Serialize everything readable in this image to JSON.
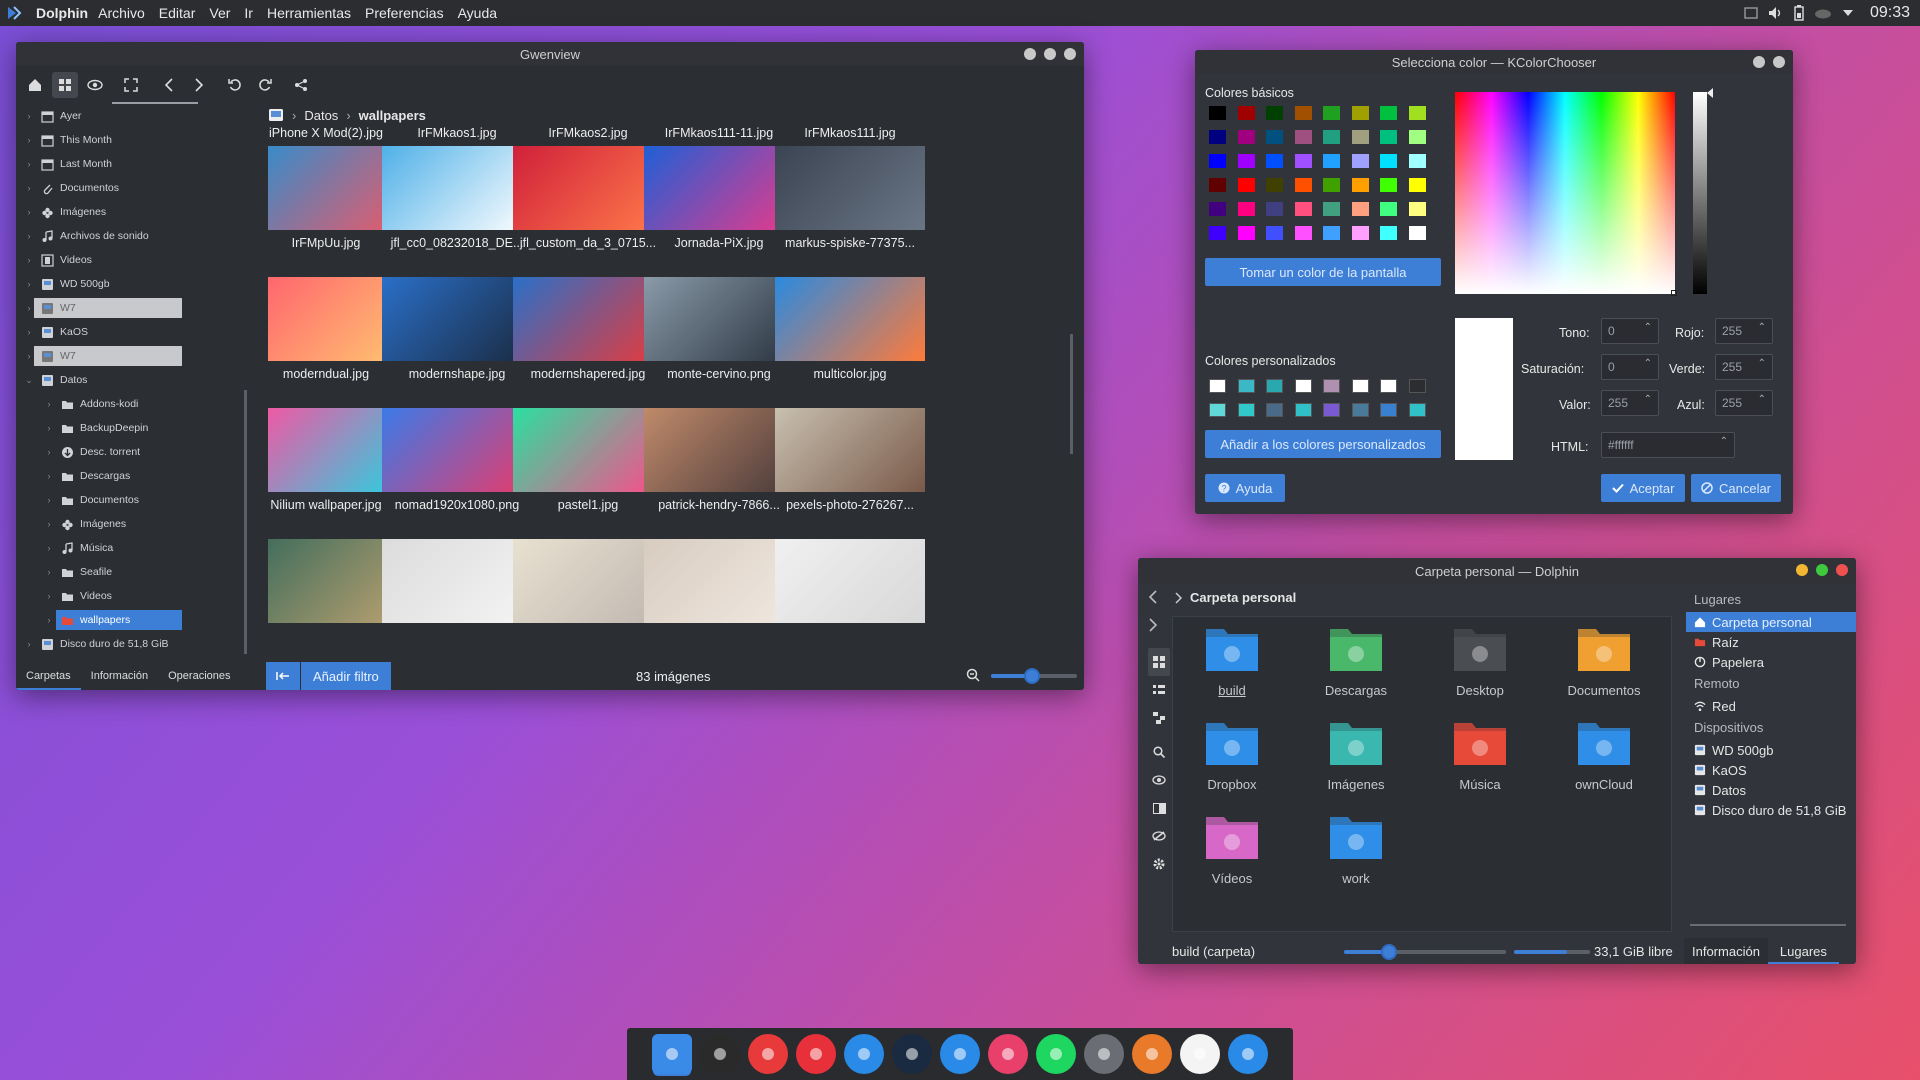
{
  "topbar": {
    "app": "Dolphin",
    "menu": [
      "Archivo",
      "Editar",
      "Ver",
      "Ir",
      "Herramientas",
      "Preferencias",
      "Ayuda"
    ],
    "clock": "09:33"
  },
  "gwenview": {
    "title": "Gwenview",
    "tree": [
      {
        "label": "Ayer",
        "icon": "calendar-icon",
        "level": 0
      },
      {
        "label": "This Month",
        "icon": "calendar-icon",
        "level": 0
      },
      {
        "label": "Last Month",
        "icon": "calendar-icon",
        "level": 0
      },
      {
        "label": "Documentos",
        "icon": "paperclip-icon",
        "level": 0
      },
      {
        "label": "Imágenes",
        "icon": "flower-icon",
        "level": 0
      },
      {
        "label": "Archivos de sonido",
        "icon": "music-icon",
        "level": 0
      },
      {
        "label": "Videos",
        "icon": "film-icon",
        "level": 0
      },
      {
        "label": "WD 500gb",
        "icon": "drive-icon",
        "level": 0
      },
      {
        "label": "W7",
        "icon": "drive-icon",
        "level": 0,
        "state": "grey"
      },
      {
        "label": "KaOS",
        "icon": "drive-icon",
        "level": 0
      },
      {
        "label": "W7",
        "icon": "drive-icon",
        "level": 0,
        "state": "grey"
      },
      {
        "label": "Datos",
        "icon": "drive-icon",
        "level": 0,
        "expanded": true
      },
      {
        "label": "Addons-kodi",
        "icon": "folder-icon",
        "level": 1
      },
      {
        "label": "BackupDeepin",
        "icon": "folder-icon",
        "level": 1
      },
      {
        "label": "Desc. torrent",
        "icon": "download-icon",
        "level": 1
      },
      {
        "label": "Descargas",
        "icon": "folder-icon",
        "level": 1
      },
      {
        "label": "Documentos",
        "icon": "folder-icon",
        "level": 1
      },
      {
        "label": "Imágenes",
        "icon": "flower-icon",
        "level": 1
      },
      {
        "label": "Música",
        "icon": "music-icon",
        "level": 1
      },
      {
        "label": "Seafile",
        "icon": "folder-icon",
        "level": 1
      },
      {
        "label": "Videos",
        "icon": "folder-icon",
        "level": 1
      },
      {
        "label": "wallpapers",
        "icon": "folder-red-icon",
        "level": 1,
        "state": "selected"
      },
      {
        "label": "Disco duro de 51,8 GiB",
        "icon": "drive-icon",
        "level": 0
      }
    ],
    "tabs": [
      "Carpetas",
      "Información",
      "Operaciones"
    ],
    "breadcrumb": [
      "Datos",
      "wallpapers"
    ],
    "top_captions": [
      "iPhone X Mod(2).jpg",
      "IrFMkaos1.jpg",
      "IrFMkaos2.jpg",
      "IrFMkaos111-11.jpg",
      "IrFMkaos111.jpg"
    ],
    "thumbs": [
      {
        "name": "IrFMpUu.jpg",
        "c1": "#2a8fd0",
        "c2": "#e85a6a"
      },
      {
        "name": "jfl_cc0_08232018_DE...",
        "c1": "#4fb0e8",
        "c2": "#ffffff"
      },
      {
        "name": "jfl_custom_da_3_0715...",
        "c1": "#d0203a",
        "c2": "#ff7a4a"
      },
      {
        "name": "Jornada-PiX.jpg",
        "c1": "#1f5fd6",
        "c2": "#e83a8a"
      },
      {
        "name": "markus-spiske-77375...",
        "c1": "#3a4452",
        "c2": "#6a7585"
      },
      {
        "name": "moderndual.jpg",
        "c1": "#ff5f6d",
        "c2": "#ffc371"
      },
      {
        "name": "modernshape.jpg",
        "c1": "#2a6fc8",
        "c2": "#1a2a40"
      },
      {
        "name": "modernshapered.jpg",
        "c1": "#2a6fc8",
        "c2": "#e83a3a"
      },
      {
        "name": "monte-cervino.png",
        "c1": "#8a9aa8",
        "c2": "#2a3440"
      },
      {
        "name": "multicolor.jpg",
        "c1": "#2a8ae0",
        "c2": "#ff7a3a"
      },
      {
        "name": "Nilium wallpaper.jpg",
        "c1": "#ff4fa0",
        "c2": "#2ad0e0"
      },
      {
        "name": "nomad1920x1080.png",
        "c1": "#3a7ae8",
        "c2": "#e83a6a"
      },
      {
        "name": "pastel1.jpg",
        "c1": "#2ae0a0",
        "c2": "#ff4a8a"
      },
      {
        "name": "patrick-hendry-7866...",
        "c1": "#c08a6a",
        "c2": "#4a3a3a"
      },
      {
        "name": "pexels-photo-276267...",
        "c1": "#c8c0b0",
        "c2": "#7a5a4a"
      },
      {
        "name": "",
        "c1": "#3a6a5a",
        "c2": "#b8a070"
      },
      {
        "name": "",
        "c1": "#dcdcdc",
        "c2": "#f4f4f4"
      },
      {
        "name": "",
        "c1": "#e8e0d0",
        "c2": "#c0b8b0"
      },
      {
        "name": "",
        "c1": "#d8ccc0",
        "c2": "#f0e8e0"
      },
      {
        "name": "",
        "c1": "#f0f0f0",
        "c2": "#d8d8d8"
      }
    ],
    "filter_label": "Añadir filtro",
    "count": "83 imágenes",
    "zoom_fraction": 0.48
  },
  "colorchooser": {
    "title": "Selecciona color — KColorChooser",
    "basic_label": "Colores básicos",
    "basic_colors": [
      "#000000",
      "#a00000",
      "#004000",
      "#a05000",
      "#20a020",
      "#a0a000",
      "#00c040",
      "#a0e020",
      "#000080",
      "#a00080",
      "#005080",
      "#a05080",
      "#20a080",
      "#a0a080",
      "#00c080",
      "#a0ff80",
      "#0000ff",
      "#a000ff",
      "#0050ff",
      "#a050ff",
      "#20a0ff",
      "#a0a0ff",
      "#00e0ff",
      "#a0ffff",
      "#600000",
      "#ff0000",
      "#404000",
      "#ff5000",
      "#40a000",
      "#ffa000",
      "#40ff00",
      "#ffff00",
      "#400080",
      "#ff0080",
      "#404080",
      "#ff5080",
      "#40a080",
      "#ffa080",
      "#40ff80",
      "#ffff80",
      "#4000ff",
      "#ff00ff",
      "#4050ff",
      "#ff50ff",
      "#40a0ff",
      "#ffa0ff",
      "#40ffff",
      "#ffffff"
    ],
    "pick_screen": "Tomar un color de la pantalla",
    "custom_label": "Colores personalizados",
    "custom_colors": [
      "#ffffff",
      "#3ab8c8",
      "#2aa8b0",
      "#ffffff",
      "#b090b0",
      "#ffffff",
      "#ffffff",
      "#2b2d31",
      "#60d8d8",
      "#30c8c8",
      "#4a6a8a",
      "#30c0c8",
      "#7a5ad0",
      "#4a7a9a",
      "#3a80d0",
      "#30c0c8"
    ],
    "add_custom": "Añadir a los colores personalizados",
    "help": "Ayuda",
    "fields": {
      "hue_label": "Tono:",
      "hue": "0",
      "sat_label": "Saturación:",
      "sat": "0",
      "val_label": "Valor:",
      "val": "255",
      "red_label": "Rojo:",
      "red": "255",
      "green_label": "Verde:",
      "green": "255",
      "blue_label": "Azul:",
      "blue": "255",
      "html_label": "HTML:",
      "html": "#ffffff"
    },
    "ok": "Aceptar",
    "cancel": "Cancelar",
    "current_color": "#ffffff"
  },
  "dolphin": {
    "title": "Carpeta personal — Dolphin",
    "location": "Carpeta personal",
    "folders": [
      {
        "name": "build",
        "color": "#2f8fe8",
        "icon": "folder-icon"
      },
      {
        "name": "Descargas",
        "color": "#4ab86a",
        "icon": "download-icon"
      },
      {
        "name": "Desktop",
        "color": "#4a4d52",
        "icon": "desktop-icon"
      },
      {
        "name": "Documentos",
        "color": "#f0a030",
        "icon": "document-icon"
      },
      {
        "name": "Dropbox",
        "color": "#2f8fe8",
        "icon": "dropbox-icon"
      },
      {
        "name": "Imágenes",
        "color": "#3ab8b0",
        "icon": "flower-icon"
      },
      {
        "name": "Música",
        "color": "#e84a3a",
        "icon": "music-icon"
      },
      {
        "name": "ownCloud",
        "color": "#2f8fe8",
        "icon": "folder-icon"
      },
      {
        "name": "Vídeos",
        "color": "#d868c8",
        "icon": "film-icon"
      },
      {
        "name": "work",
        "color": "#2f8fe8",
        "icon": "folder-icon"
      }
    ],
    "places": {
      "lugares_label": "Lugares",
      "lugares": [
        {
          "label": "Carpeta personal",
          "icon": "home-icon",
          "selected": true
        },
        {
          "label": "Raíz",
          "icon": "folder-red-icon"
        },
        {
          "label": "Papelera",
          "icon": "trash-icon"
        }
      ],
      "remoto_label": "Remoto",
      "remoto": [
        {
          "label": "Red",
          "icon": "wifi-icon"
        }
      ],
      "dispositivos_label": "Dispositivos",
      "dispositivos": [
        {
          "label": "WD 500gb",
          "icon": "drive-icon"
        },
        {
          "label": "KaOS",
          "icon": "drive-icon"
        },
        {
          "label": "Datos",
          "icon": "drive-icon"
        },
        {
          "label": "Disco duro de 51,8 GiB",
          "icon": "drive-icon"
        }
      ]
    },
    "status": "build (carpeta)",
    "free": "33,1 GiB libre",
    "zoom_fraction": 0.28,
    "free_fraction": 0.7,
    "tabs": [
      "Información",
      "Lugares"
    ]
  },
  "dock": [
    {
      "name": "finder-icon",
      "bg": "#3a8ae8"
    },
    {
      "name": "terminal-icon",
      "bg": "#2a2a2a"
    },
    {
      "name": "vivaldi-icon",
      "bg": "#e83a3a"
    },
    {
      "name": "opera-icon",
      "bg": "#e8303a"
    },
    {
      "name": "deepin-icon",
      "bg": "#2a8ae8"
    },
    {
      "name": "steam-icon",
      "bg": "#1a2a40"
    },
    {
      "name": "music-app-icon",
      "bg": "#2a8ae8"
    },
    {
      "name": "calendar-app-icon",
      "bg": "#e8406a"
    },
    {
      "name": "spotify-icon",
      "bg": "#1ed760"
    },
    {
      "name": "network-icon",
      "bg": "#6a6e74"
    },
    {
      "name": "gimp-icon",
      "bg": "#e87a2a"
    },
    {
      "name": "drop-icon",
      "bg": "#f4f4f4"
    },
    {
      "name": "files-icon",
      "bg": "#2a8ae8"
    }
  ]
}
